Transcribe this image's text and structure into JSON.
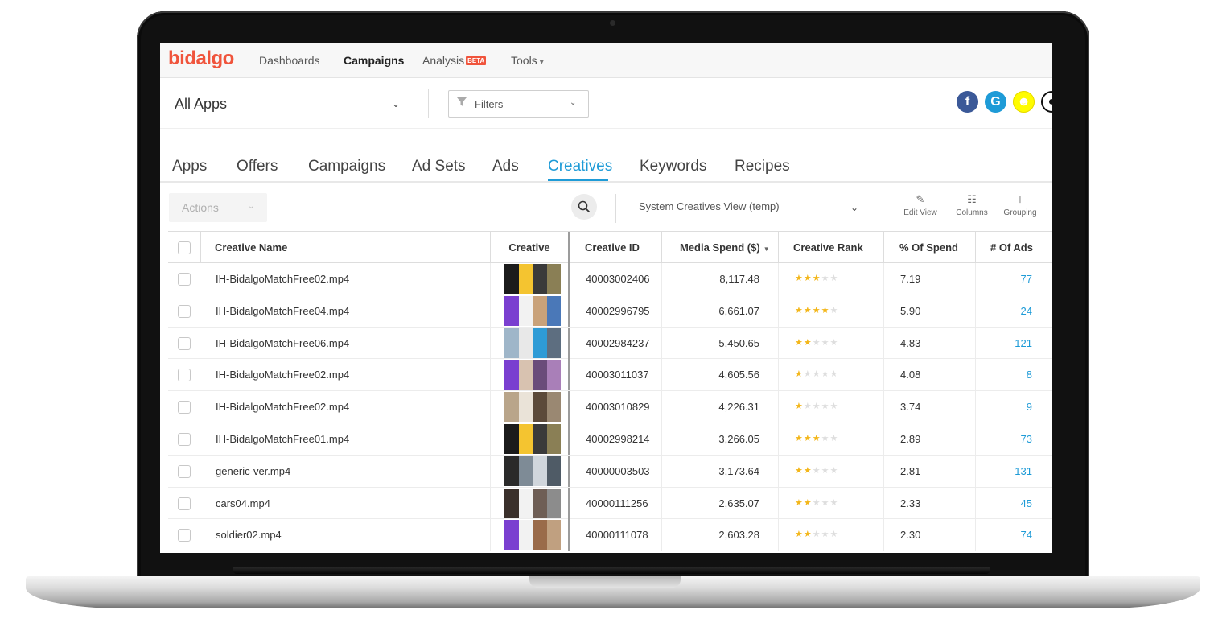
{
  "brand": {
    "logo_text": "bidalgo",
    "accent": "#f0543c",
    "link_color": "#1e9bd7",
    "star_color": "#f3b619"
  },
  "topnav": {
    "items": [
      {
        "label": "Dashboards",
        "active": false
      },
      {
        "label": "Campaigns",
        "active": true
      },
      {
        "label": "Analysis",
        "badge": "BETA",
        "active": false
      },
      {
        "label": "Tools",
        "has_dropdown": true,
        "active": false
      }
    ]
  },
  "appbar": {
    "app_selector": "All Apps",
    "filters_label": "Filters",
    "networks": [
      {
        "name": "facebook-icon",
        "glyph": "f",
        "color": "#3b5998"
      },
      {
        "name": "google-icon",
        "glyph": "G",
        "color": "#1e9bd7"
      },
      {
        "name": "snapchat-icon",
        "glyph": "☺",
        "color": "#fffc00"
      },
      {
        "name": "apple-icon",
        "glyph": "",
        "color": "#222222"
      }
    ]
  },
  "tabs": [
    {
      "label": "Apps",
      "active": false
    },
    {
      "label": "Offers",
      "active": false
    },
    {
      "label": "Campaigns",
      "active": false
    },
    {
      "label": "Ad Sets",
      "active": false
    },
    {
      "label": "Ads",
      "active": false
    },
    {
      "label": "Creatives",
      "active": true
    },
    {
      "label": "Keywords",
      "active": false
    },
    {
      "label": "Recipes",
      "active": false
    }
  ],
  "toolbar": {
    "actions_label": "Actions",
    "view_label": "System Creatives View (temp)",
    "edit_view_label": "Edit View",
    "columns_label": "Columns",
    "grouping_label": "Grouping"
  },
  "table": {
    "columns": [
      "Creative Name",
      "Creative",
      "Creative ID",
      "Media Spend ($)",
      "Creative Rank",
      "% Of Spend",
      "# Of Ads"
    ],
    "sort": {
      "column": "Media Spend ($)",
      "direction": "desc"
    },
    "rows": [
      {
        "name": "IH-BidalgoMatchFree02.mp4",
        "id": "40003002406",
        "spend": "8,117.48",
        "rank": 3,
        "pct": "7.19",
        "ads": "77"
      },
      {
        "name": "IH-BidalgoMatchFree04.mp4",
        "id": "40002996795",
        "spend": "6,661.07",
        "rank": 4,
        "pct": "5.90",
        "ads": "24"
      },
      {
        "name": "IH-BidalgoMatchFree06.mp4",
        "id": "40002984237",
        "spend": "5,450.65",
        "rank": 2,
        "pct": "4.83",
        "ads": "121"
      },
      {
        "name": "IH-BidalgoMatchFree02.mp4",
        "id": "40003011037",
        "spend": "4,605.56",
        "rank": 1,
        "pct": "4.08",
        "ads": "8"
      },
      {
        "name": "IH-BidalgoMatchFree02.mp4",
        "id": "40003010829",
        "spend": "4,226.31",
        "rank": 1,
        "pct": "3.74",
        "ads": "9"
      },
      {
        "name": "IH-BidalgoMatchFree01.mp4",
        "id": "40002998214",
        "spend": "3,266.05",
        "rank": 3,
        "pct": "2.89",
        "ads": "73"
      },
      {
        "name": "generic-ver.mp4",
        "id": "40000003503",
        "spend": "3,173.64",
        "rank": 2,
        "pct": "2.81",
        "ads": "131"
      },
      {
        "name": "cars04.mp4",
        "id": "40000111256",
        "spend": "2,635.07",
        "rank": 2,
        "pct": "2.33",
        "ads": "45"
      },
      {
        "name": "soldier02.mp4",
        "id": "40000111078",
        "spend": "2,603.28",
        "rank": 2,
        "pct": "2.30",
        "ads": "74"
      }
    ]
  }
}
